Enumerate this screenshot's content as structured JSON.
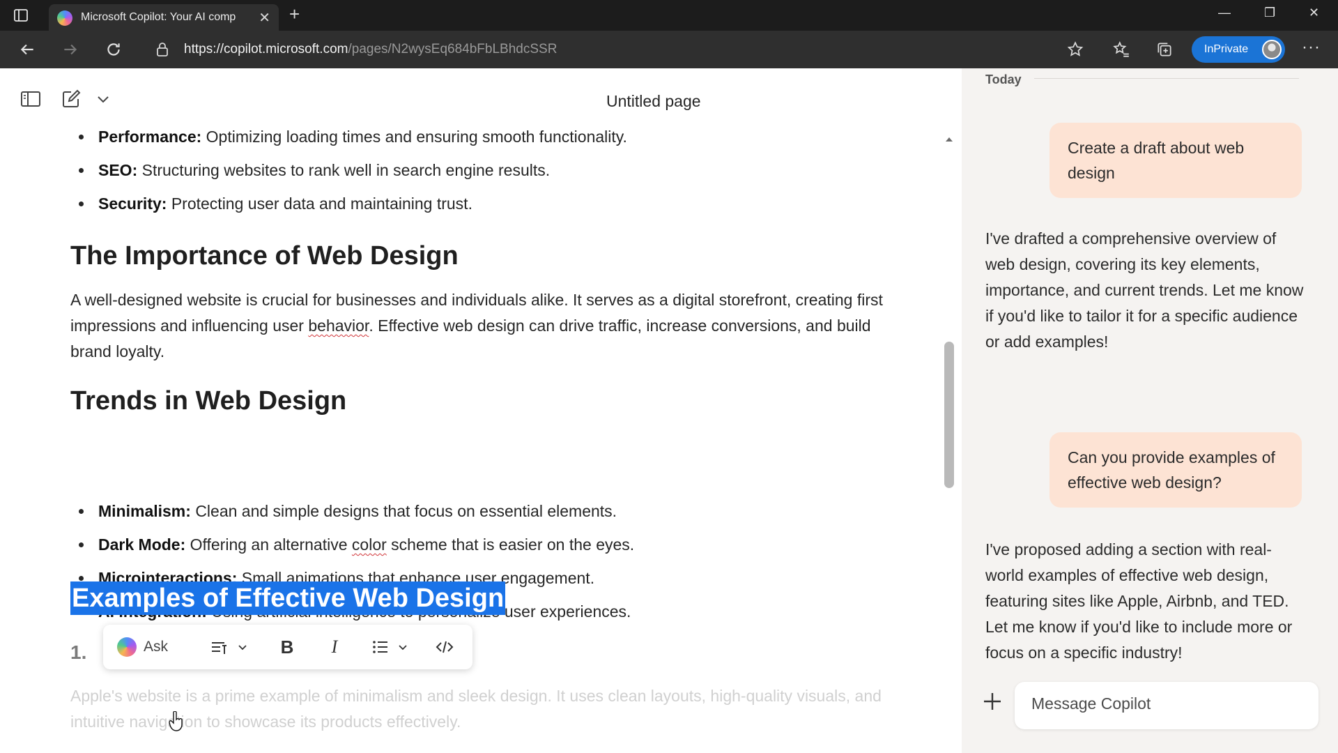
{
  "browser": {
    "tab_title": "Microsoft Copilot: Your AI comp",
    "url_host": "https://copilot.microsoft.com",
    "url_path": "/pages/N2wysEq684bFbLBhdcSSR",
    "inprivate_label": "InPrivate"
  },
  "editor": {
    "page_title": "Untitled page",
    "top_bullets": [
      {
        "term": "Performance:",
        "text": "Optimizing loading times and ensuring smooth functionality."
      },
      {
        "term": "SEO:",
        "text": "Structuring websites to rank well in search engine results."
      },
      {
        "term": "Security:",
        "text": "Protecting user data and maintaining trust."
      }
    ],
    "heading_importance": "The Importance of Web Design",
    "importance_para_before": "A well-designed website is crucial for businesses and individuals alike. It serves as a digital storefront, creating first impressions and influencing user ",
    "importance_para_word": "behavior",
    "importance_para_after": ". Effective web design can drive traffic, increase conversions, and build brand loyalty.",
    "heading_trends": "Trends in Web Design",
    "trends": [
      {
        "term": "Minimalism:",
        "text": "Clean and simple designs that focus on essential elements."
      },
      {
        "term": "Dark Mode:",
        "text": "Offering an alternative",
        "squiggle": "color",
        "text_after": "scheme that is easier on the eyes."
      },
      {
        "term": "Microinteractions:",
        "text": "Small animations that enhance user engagement."
      },
      {
        "term": "AI Integration:",
        "text": "Using artificial intelligence to personalize user experiences."
      }
    ],
    "heading_examples": "Examples of Effective Web Design",
    "list_number": "1.",
    "faded_paragraph": "Apple's website is a prime example of minimalism and sleek design. It uses clean layouts, high-quality visuals, and intuitive navigation to showcase its products effectively.",
    "toolbar": {
      "ask_label": "Ask"
    }
  },
  "chat": {
    "date_label": "Today",
    "messages": [
      {
        "role": "user",
        "text": "Create a draft about web design"
      },
      {
        "role": "assistant",
        "text": "I've drafted a comprehensive overview of web design, covering its key elements, importance, and current trends. Let me know if you'd like to tailor it for a specific audience or add examples!"
      },
      {
        "role": "user",
        "text": "Can you provide examples of effective web design?"
      },
      {
        "role": "assistant",
        "text": "I've proposed adding a section with real-world examples of effective web design, featuring sites like Apple, Airbnb, and TED. Let me know if you'd like to include more or focus on a specific industry!"
      }
    ],
    "composer_placeholder": "Message Copilot"
  },
  "colors": {
    "selection": "#1a73e8",
    "user_bubble": "#fde3d4",
    "inprivate_badge": "#1b74d6"
  }
}
